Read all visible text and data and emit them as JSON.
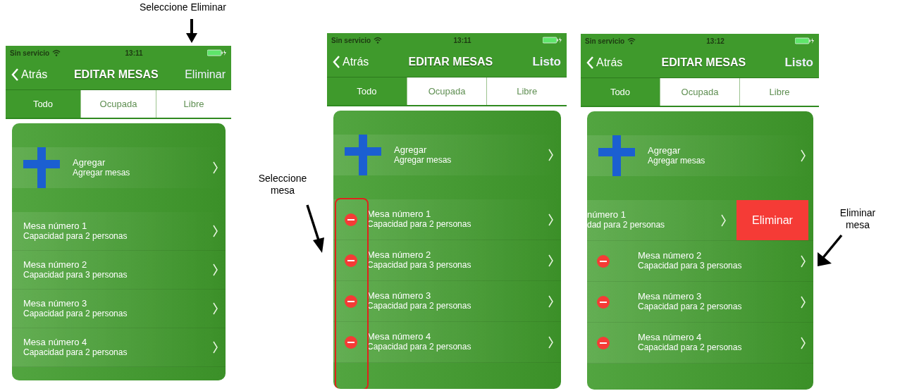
{
  "screens": [
    {
      "status": {
        "carrier": "Sin servicio",
        "time": "13:11"
      },
      "nav": {
        "back": "Atrás",
        "title": "EDITAR MESAS",
        "action": "Eliminar"
      },
      "tabs": [
        {
          "label": "Todo",
          "selected": true
        },
        {
          "label": "Ocupada",
          "selected": false
        },
        {
          "label": "Libre",
          "selected": false
        }
      ],
      "add_row": {
        "title": "Agregar",
        "subtitle": "Agregar mesas"
      },
      "rows": [
        {
          "kind": "normal",
          "title": "Mesa número 1",
          "subtitle": "Capacidad para 2 personas"
        },
        {
          "kind": "normal",
          "title": "Mesa número 2",
          "subtitle": "Capacidad para 3 personas"
        },
        {
          "kind": "normal",
          "title": "Mesa número 3",
          "subtitle": "Capacidad para 2 personas"
        },
        {
          "kind": "normal",
          "title": "Mesa número 4",
          "subtitle": "Capacidad para 2 personas"
        }
      ],
      "highlight_delete_column": false,
      "callout": {
        "kind": "down",
        "text": "Seleccione Eliminar"
      }
    },
    {
      "status": {
        "carrier": "Sin servicio",
        "time": "13:11"
      },
      "nav": {
        "back": "Atrás",
        "title": "EDITAR MESAS",
        "action": "Listo"
      },
      "tabs": [
        {
          "label": "Todo",
          "selected": true
        },
        {
          "label": "Ocupada",
          "selected": false
        },
        {
          "label": "Libre",
          "selected": false
        }
      ],
      "add_row": {
        "title": "Agregar",
        "subtitle": "Agregar mesas"
      },
      "rows": [
        {
          "kind": "deletable",
          "title": "Mesa número 1",
          "subtitle": "Capacidad para 2 personas"
        },
        {
          "kind": "deletable",
          "title": "Mesa número 2",
          "subtitle": "Capacidad para 3 personas"
        },
        {
          "kind": "deletable",
          "title": "Mesa número 3",
          "subtitle": "Capacidad para 2 personas"
        },
        {
          "kind": "deletable",
          "title": "Mesa número 4",
          "subtitle": "Capacidad para 2 personas"
        }
      ],
      "highlight_delete_column": true,
      "callout": {
        "kind": "downright",
        "text": "Seleccione mesa"
      }
    },
    {
      "status": {
        "carrier": "Sin servicio",
        "time": "13:12"
      },
      "nav": {
        "back": "Atrás",
        "title": "EDITAR MESAS",
        "action": "Listo"
      },
      "tabs": [
        {
          "label": "Todo",
          "selected": true
        },
        {
          "label": "Ocupada",
          "selected": false
        },
        {
          "label": "Libre",
          "selected": false
        }
      ],
      "add_row": {
        "title": "Agregar",
        "subtitle": "Agregar mesas"
      },
      "rows": [
        {
          "kind": "swiped",
          "title": "número 1",
          "subtitle": "dad para 2 personas",
          "action": "Eliminar"
        },
        {
          "kind": "deletable",
          "title": "Mesa número 2",
          "subtitle": "Capacidad para 3 personas"
        },
        {
          "kind": "deletable",
          "title": "Mesa número 3",
          "subtitle": "Capacidad para 2 personas"
        },
        {
          "kind": "deletable",
          "title": "Mesa número 4",
          "subtitle": "Capacidad para 2 personas"
        }
      ],
      "highlight_delete_column": false,
      "callout": {
        "kind": "downleft",
        "text": "Eliminar mesa"
      }
    }
  ]
}
